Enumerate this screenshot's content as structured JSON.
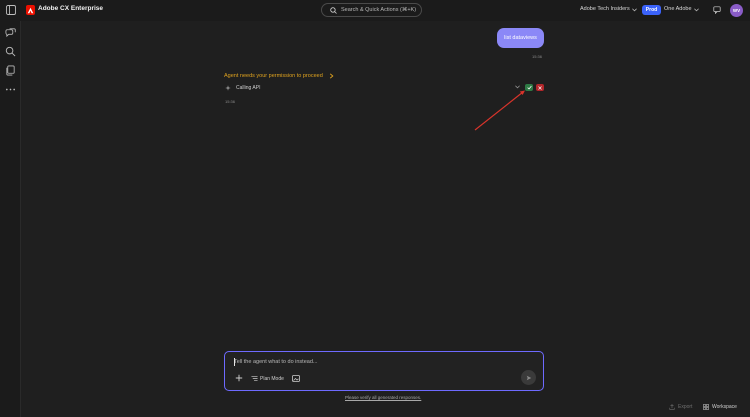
{
  "header": {
    "app_title": "Adobe CX Enterprise",
    "search_placeholder": "Search & Quick Actions (⌘+K)",
    "org_name": "Adobe Tech Insiders",
    "env_badge": "Prod",
    "org_switcher": "One Adobe",
    "avatar_initials": "WV"
  },
  "sidebar": {
    "items": [
      "chat-icon",
      "search-icon",
      "documents-icon",
      "more-icon"
    ]
  },
  "conversation": {
    "user_message": "list dataviews",
    "user_time": "15:36",
    "permission_text": "Agent needs your permission to proceed",
    "step_label": "Calling API",
    "agent_time": "15:36"
  },
  "composer": {
    "placeholder": "Tell the agent what to do instead...",
    "plan_mode_label": "Plan Mode"
  },
  "footer": {
    "disclaimer": "Please verify all generated responses.",
    "export_label": "Export",
    "workspace_label": "Workspace"
  },
  "colors": {
    "accent": "#6e6aff",
    "user_bubble": "#8b88f7",
    "warning": "#e0a31f",
    "approve": "#2d7a44",
    "reject": "#b3262a",
    "annotation_arrow": "#d9342b"
  }
}
